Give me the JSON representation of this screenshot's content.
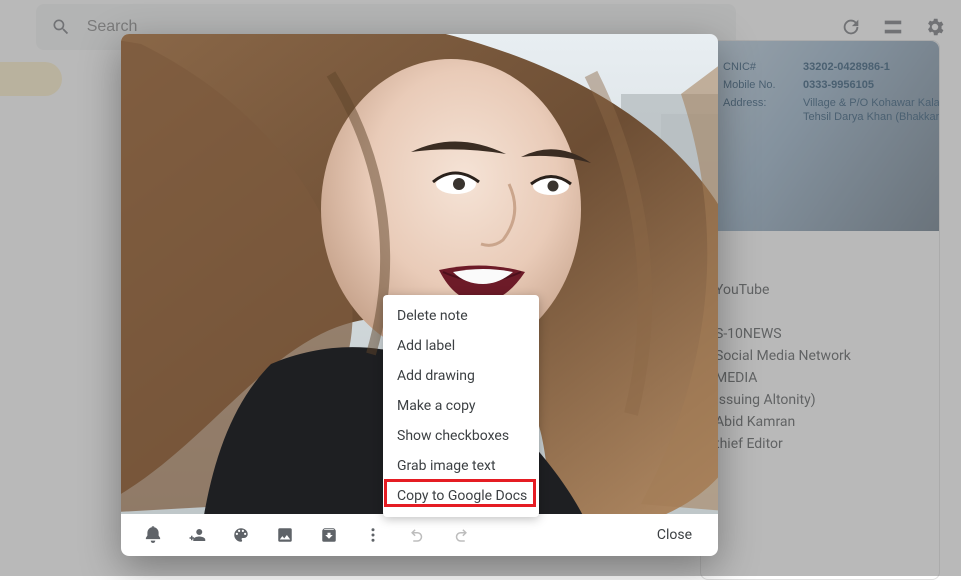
{
  "search": {
    "placeholder": "Search"
  },
  "id_card": {
    "cnic_label": "CNIC#",
    "cnic_value": "33202-0428986-1",
    "mobile_label": "Mobile No.",
    "mobile_value": "0333-9956105",
    "address_label": "Address:",
    "address_value1": "Village & P/O Kohawar Kalan",
    "address_value2": "Tehsil Darya Khan (Bhakkar)"
  },
  "bg_note_lines": [
    "YouTube",
    "",
    "S-10NEWS",
    "Social Media Network",
    "MEDIA",
    "Issuing Altonity)",
    "Abid Kamran",
    "thief Editor"
  ],
  "context_menu": {
    "items": [
      "Delete note",
      "Add label",
      "Add drawing",
      "Make a copy",
      "Show checkboxes",
      "Grab image text",
      "Copy to Google Docs"
    ],
    "highlighted_index": 6
  },
  "modal": {
    "close_label": "Close"
  }
}
